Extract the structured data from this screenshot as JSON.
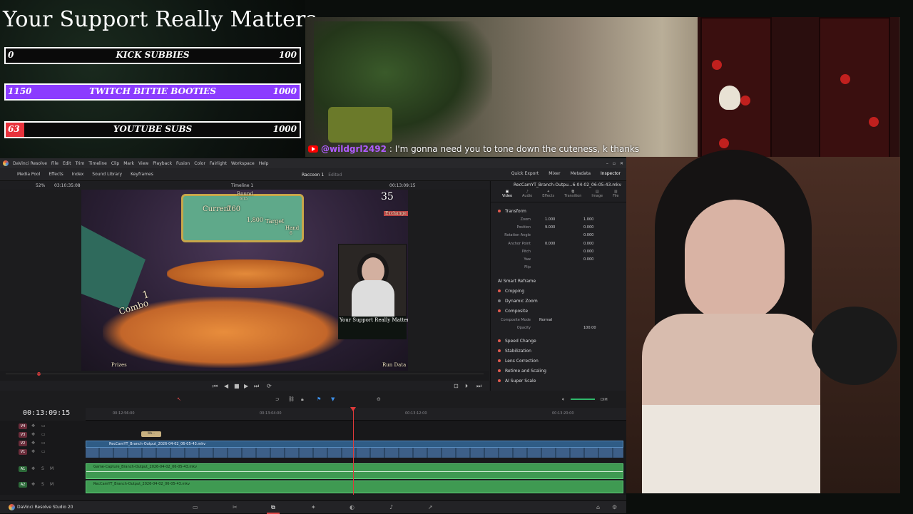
{
  "overlay": {
    "title": "Your Support Really Matters",
    "goals": [
      {
        "current": "0",
        "label": "KICK SUBBIES",
        "target": "100",
        "fill_fraction": 0,
        "color": "#7a3aff"
      },
      {
        "current": "1150",
        "label": "TWITCH BITTIE BOOTIES",
        "target": "1000",
        "fill_fraction": 1.0,
        "color": "#8b3cff"
      },
      {
        "current": "63",
        "label": "YOUTUBE SUBS",
        "target": "1000",
        "fill_fraction": 0.063,
        "color": "#e8323c"
      }
    ]
  },
  "chat": {
    "platform_icon": "youtube-icon",
    "user": "@wildgrl2492",
    "message": ": I'm gonna need you to tone down the cuteness, k thanks"
  },
  "resolve": {
    "app_title": "DaVinci Resolve",
    "menus": [
      "File",
      "Edit",
      "Trim",
      "Timeline",
      "Clip",
      "Mark",
      "View",
      "Playback",
      "Fusion",
      "Color",
      "Fairlight",
      "Workspace",
      "Help"
    ],
    "toolbar_left": [
      "Media Pool",
      "Effects",
      "Index",
      "Sound Library",
      "Keyframes"
    ],
    "project_name": "Raccoon 1",
    "project_status": "Edited",
    "toolbar_right": [
      "Quick Export",
      "Mixer",
      "Metadata",
      "Inspector"
    ],
    "viewer": {
      "zoom": "52%",
      "source_timecode": "03:10:35:08",
      "timeline_name": "Timeline 1",
      "record_timecode": "00:13:09:15",
      "game_text": {
        "round": "Round",
        "round_num": "6/15",
        "current": "Current",
        "current_val": "760",
        "target_val": "1,800",
        "target": "Target",
        "hand": "Hand",
        "hand_num": "6",
        "combo": "Combo",
        "combo_num": "1",
        "counter": "35",
        "exchange": "Exchange",
        "prizes": "Prizes",
        "run_data": "Run Data",
        "mini_title": "Your Support Really Matters"
      }
    },
    "inspector": {
      "clip_name": "RecCamYT_Branch-Outpu...6-04-02_06-05-43.mkv",
      "tabs": [
        "Video",
        "Audio",
        "Effects",
        "Transition",
        "Image",
        "File"
      ],
      "sections": {
        "transform": "Transform",
        "ai_reframe": "AI Smart Reframe",
        "cropping": "Cropping",
        "dynamic_zoom": "Dynamic Zoom",
        "composite": "Composite",
        "speed_change": "Speed Change",
        "stabilization": "Stabilization",
        "lens_correction": "Lens Correction",
        "retime": "Retime and Scaling",
        "ai_super_scale": "AI Super Scale"
      },
      "fields": [
        {
          "label": "Zoom",
          "x": "1.000",
          "y": "1.000"
        },
        {
          "label": "Position",
          "x": "9.000",
          "y": "0.000"
        },
        {
          "label": "Rotation Angle",
          "x": "",
          "y": "0.000"
        },
        {
          "label": "Anchor Point",
          "x": "0.000",
          "y": "0.000"
        },
        {
          "label": "Pitch",
          "x": "",
          "y": "0.000"
        },
        {
          "label": "Yaw",
          "x": "",
          "y": "0.000"
        },
        {
          "label": "Flip",
          "x": "",
          "y": ""
        }
      ],
      "composite_mode_label": "Composite Mode",
      "composite_mode": "Normal",
      "opacity_label": "Opacity",
      "opacity": "100.00"
    },
    "timeline": {
      "timecode": "00:13:09:15",
      "ruler": [
        "00:12:56:00",
        "00:13:04:00",
        "00:13:12:00",
        "00:13:20:00"
      ],
      "video_tracks": [
        "V4",
        "V3",
        "V2",
        "V1"
      ],
      "audio_tracks": [
        "A1",
        "A2"
      ],
      "clips": {
        "v2": "RecCamYT_Branch-Output_2026-04-02_06-05-43.mkv",
        "a1": "Game-Capture_Branch-Output_2026-04-02_06-05-43.mkv",
        "a2": "RecCamYT_Branch-Output_2026-04-02_06-05-43.mkv",
        "small": "Wa..."
      },
      "dim": "DIM"
    },
    "footer": {
      "app_version": "DaVinci Resolve Studio 20"
    }
  }
}
